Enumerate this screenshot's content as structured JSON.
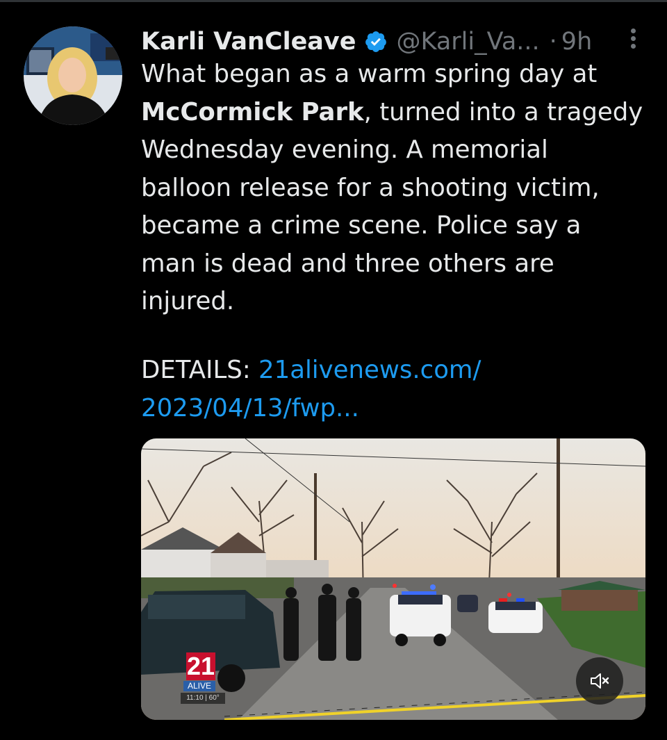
{
  "author": {
    "display_name": "Karli VanCleave",
    "handle": "@Karli_Va...",
    "separator": "·",
    "time_ago": "9h",
    "verified": true
  },
  "tweet": {
    "line1": "What began as a warm spring day at",
    "line2_bold": "McCormick Park",
    "line2_rest": ", turned into a tragedy",
    "line3": "Wednesday evening. A memorial",
    "line4": "balloon release for a shooting victim,",
    "line5": "became a crime scene. Police say a",
    "line6": "man is dead and three others are",
    "line7": "injured.",
    "details_label": "DETAILS: ",
    "link_line1": "21alivenews.com/",
    "link_line2": "2023/04/13/fwp..."
  },
  "media": {
    "station_number": "21",
    "station_name": "ALIVE",
    "time_temp": "11:10 | 60°",
    "mute_icon": "speaker-muted-icon"
  },
  "colors": {
    "background": "#000000",
    "text": "#e7e9ea",
    "muted": "#71767b",
    "link": "#1d9bf0",
    "verified": "#1d9bf0"
  }
}
